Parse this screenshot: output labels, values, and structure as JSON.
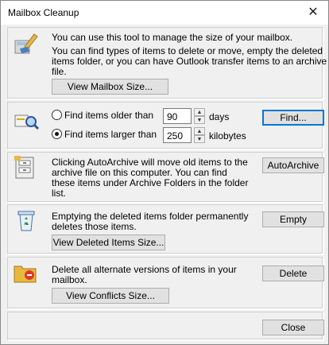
{
  "window": {
    "title": "Mailbox Cleanup"
  },
  "sections": {
    "mailbox": {
      "line1": "You can use this tool to manage the size of your mailbox.",
      "line2": "You can find types of items to delete or move, empty the deleted",
      "line3": "items folder, or you can have Outlook transfer items to an archive",
      "line4": "file.",
      "button": "View Mailbox Size..."
    },
    "find": {
      "older_label": "Find items older than",
      "older_value": "90",
      "older_unit": "days",
      "larger_label": "Find items larger than",
      "larger_value": "250",
      "larger_unit": "kilobytes",
      "button": "Find..."
    },
    "archive": {
      "line1": "Clicking AutoArchive will move old items to the",
      "line2": "archive file on this computer. You can find",
      "line3": "these items under Archive Folders in the folder",
      "line4": "list.",
      "button": "AutoArchive"
    },
    "deleted": {
      "line1": "Emptying the deleted items folder permanently",
      "line2": "deletes those items.",
      "button_view": "View Deleted Items Size...",
      "button_empty": "Empty"
    },
    "conflicts": {
      "line1": "Delete all alternate versions of items in your",
      "line2": "mailbox.",
      "button_view": "View Conflicts Size...",
      "button_delete": "Delete"
    }
  },
  "footer": {
    "close": "Close"
  },
  "titlebar_close_glyph": "✕"
}
